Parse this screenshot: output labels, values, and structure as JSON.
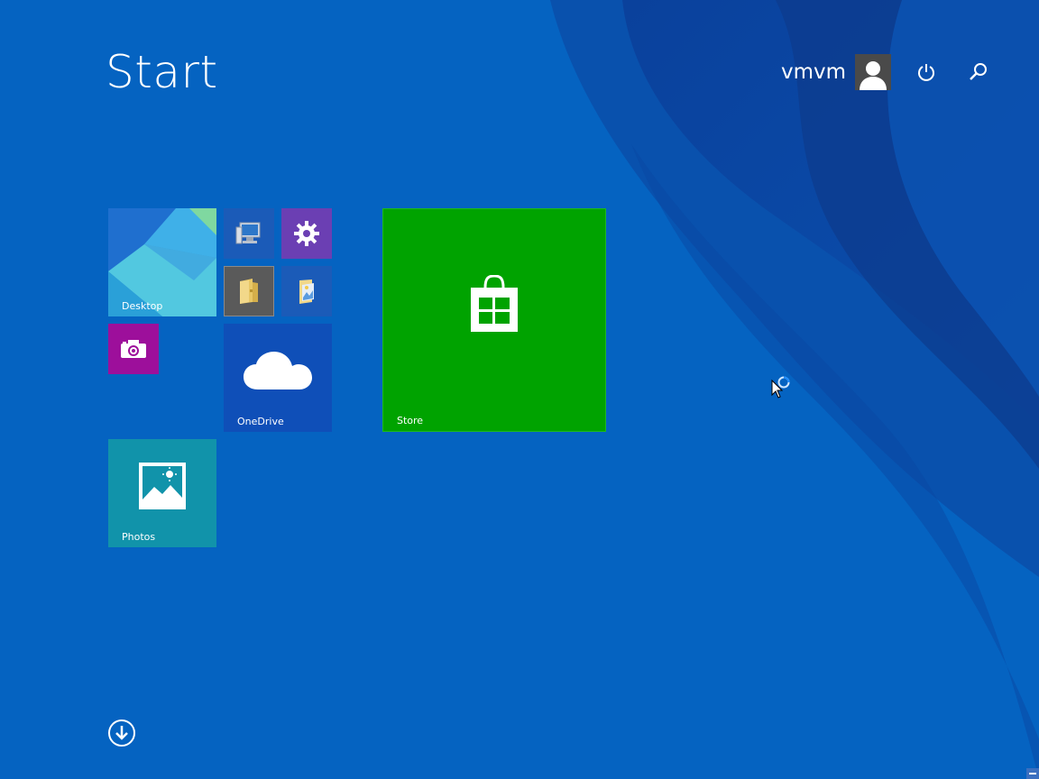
{
  "header": {
    "title": "Start"
  },
  "user": {
    "name": "vmvm",
    "avatar_icon": "user-silhouette-icon"
  },
  "top_buttons": {
    "power_icon": "power-icon",
    "search_icon": "search-icon"
  },
  "tiles": {
    "desktop": {
      "label": "Desktop",
      "color": "#2a8fd6"
    },
    "this_pc": {
      "label": "",
      "icon": "computer-icon",
      "color": "#1b5bb8"
    },
    "settings": {
      "label": "",
      "icon": "gear-icon",
      "color": "#6b3fb3"
    },
    "file_explorer_1": {
      "label": "",
      "icon": "folder-icon",
      "color": "#5a5a5a"
    },
    "file_explorer_2": {
      "label": "",
      "icon": "folder-pictures-icon",
      "color": "#1b5bb8"
    },
    "camera": {
      "label": "",
      "icon": "camera-icon",
      "color": "#9d0f9b"
    },
    "onedrive": {
      "label": "OneDrive",
      "icon": "cloud-icon",
      "color": "#0f4fb8"
    },
    "store": {
      "label": "Store",
      "icon": "shopping-bag-icon",
      "color": "#00a300"
    },
    "photos": {
      "label": "Photos",
      "icon": "photo-icon",
      "color": "#1193aa"
    }
  },
  "footer": {
    "all_apps_icon": "down-arrow-circle-icon"
  },
  "colors": {
    "background": "#0563c1",
    "accent": "#00a300"
  }
}
